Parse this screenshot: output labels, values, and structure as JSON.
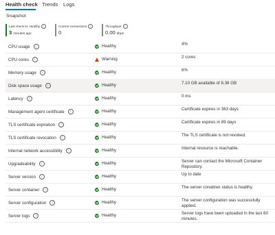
{
  "tabs": [
    {
      "label": "Health check"
    },
    {
      "label": "Trends"
    },
    {
      "label": "Logs"
    }
  ],
  "snapshot": {
    "title": "Snapshot",
    "cards": [
      {
        "label": "Last check-in: Healthy",
        "value": "3",
        "unit": "minutes ago"
      },
      {
        "label": "Current connections",
        "value": "0",
        "unit": ""
      },
      {
        "label": "Throughput",
        "value": "0.00",
        "unit": "kbps"
      }
    ]
  },
  "rows": [
    {
      "name": "CPU usage",
      "status": "Healthy",
      "detail": "4%"
    },
    {
      "name": "CPU cores",
      "status": "Warning",
      "detail": "2 cores"
    },
    {
      "name": "Memory usage",
      "status": "Healthy",
      "detail": "6%"
    },
    {
      "name": "Disk space usage",
      "status": "Healthy",
      "detail": "7.10 GB available of 8.38 GB"
    },
    {
      "name": "Latency",
      "status": "Healthy",
      "detail": "0 ms"
    },
    {
      "name": "Management agent certificate",
      "status": "Healthy",
      "detail": "Certificate expires in 363 days"
    },
    {
      "name": "TLS certificate expiration",
      "status": "Healthy",
      "detail": "Certificate expires in 89 days"
    },
    {
      "name": "TLS certificate revocation",
      "status": "Healthy",
      "detail": "The TLS certificate is not revoked."
    },
    {
      "name": "Internal network accessibility",
      "status": "Healthy",
      "detail": "Internal resource is reachable."
    },
    {
      "name": "Upgradeability",
      "status": "Healthy",
      "detail": "Server can contact the Microsoft Container Repository."
    },
    {
      "name": "Server version",
      "status": "Healthy",
      "detail": "Up to date"
    },
    {
      "name": "Server container",
      "status": "Healthy",
      "detail": "The server conatiner status is healthy."
    },
    {
      "name": "Server configuration",
      "status": "Healthy",
      "detail": "The server configuration was successfully applied."
    },
    {
      "name": "Server logs",
      "status": "Healthy",
      "detail": "Server logs have been uploaded in the last 60 minutes."
    }
  ],
  "colors": {
    "accent": "#0078d4",
    "healthy": "#107c10",
    "warning": "#d83b01"
  }
}
